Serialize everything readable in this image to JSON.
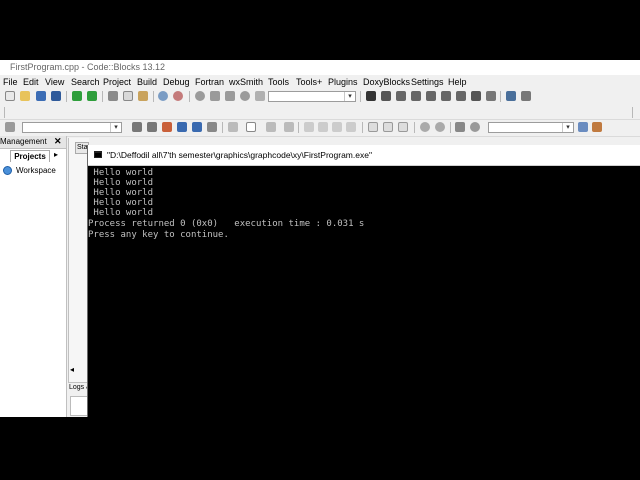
{
  "window": {
    "title": "FirstProgram.cpp - Code::Blocks 13.12"
  },
  "menu": [
    "File",
    "Edit",
    "View",
    "Search",
    "Project",
    "Build",
    "Debug",
    "Fortran",
    "wxSmith",
    "Tools",
    "Tools+",
    "Plugins",
    "DoxyBlocks",
    "Settings",
    "Help"
  ],
  "management": {
    "title": "Management",
    "close": "✕",
    "tab": "Projects",
    "nav": "▸",
    "tree_root": "Workspace"
  },
  "editor": {
    "tab_fragment": "Sta",
    "scroll_arrow": "◂",
    "logs_label": "Logs &"
  },
  "console": {
    "title": "\"D:\\Deffodil all\\7'th semester\\graphics\\graphcode\\xy\\FirstProgram.exe\"",
    "lines": [
      " Hello world",
      " Hello world",
      " Hello world",
      " Hello world",
      " Hello world",
      "Process returned 0 (0x0)   execution time : 0.031 s",
      "Press any key to continue."
    ]
  },
  "icons": [
    "new-file-icon",
    "open-icon",
    "save-icon",
    "save-all-icon",
    "undo-icon",
    "redo-icon",
    "cut-icon",
    "copy-icon",
    "paste-icon",
    "find-icon",
    "replace-icon",
    "settings-icon",
    "run-icon",
    "build-icon",
    "build-run-icon",
    "abort-icon",
    "debug-icon",
    "step-icon",
    "pause-icon",
    "stop-icon",
    "info-icon"
  ],
  "colors": {
    "console_bg": "#000000",
    "console_text": "#c0c0c0",
    "chrome": "#f0f0f0"
  }
}
